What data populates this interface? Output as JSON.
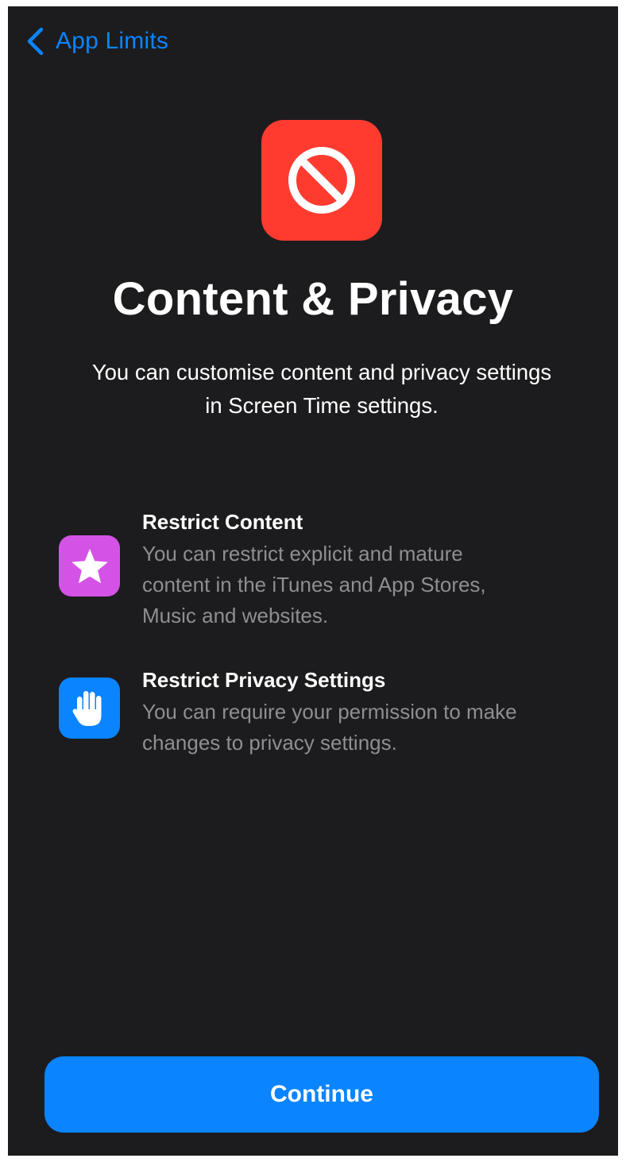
{
  "nav": {
    "back_label": "App Limits",
    "back_icon": "chevron-left-icon"
  },
  "hero": {
    "icon": "no-entry-icon",
    "title": "Content & Privacy",
    "subtitle_lines": [
      "You can customise content and privacy settings",
      "in Screen Time settings."
    ]
  },
  "features": [
    {
      "icon": "star-icon",
      "title": "Restrict Content",
      "description_lines": [
        "You can restrict explicit and mature",
        "content in the iTunes and App Stores,",
        "Music and websites."
      ]
    },
    {
      "icon": "hand-icon",
      "title": "Restrict Privacy Settings",
      "description_lines": [
        "You can require your permission to make",
        "changes to privacy settings."
      ]
    }
  ],
  "footer": {
    "continue_label": "Continue"
  },
  "colors": {
    "background": "#1c1c1e",
    "accent_blue": "#0a84ff",
    "hero_red": "#ff3b30",
    "star_purple": "#d453e6",
    "hand_blue": "#0a84ff",
    "secondary_text": "#8e8e93"
  }
}
